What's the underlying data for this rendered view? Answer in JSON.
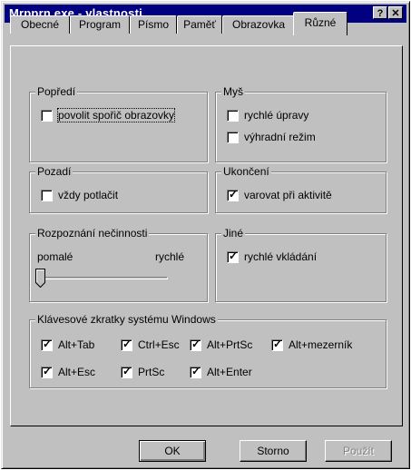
{
  "window": {
    "title": "Mrpprn.exe - vlastnosti",
    "help_button": "?",
    "close_button": "✕"
  },
  "tabs": [
    {
      "label": "Obecné",
      "active": false
    },
    {
      "label": "Program",
      "active": false
    },
    {
      "label": "Písmo",
      "active": false
    },
    {
      "label": "Paměť",
      "active": false
    },
    {
      "label": "Obrazovka",
      "active": false
    },
    {
      "label": "Různé",
      "active": true
    }
  ],
  "groups": {
    "popredi": {
      "label": "Popředí",
      "items": [
        {
          "label": "povolit spořič obrazovky",
          "checked": false
        }
      ]
    },
    "mys": {
      "label": "Myš",
      "items": [
        {
          "label": "rychlé úpravy",
          "checked": false
        },
        {
          "label": "výhradní režim",
          "checked": false
        }
      ]
    },
    "pozadi": {
      "label": "Pozadí",
      "items": [
        {
          "label": "vždy potlačit",
          "checked": false
        }
      ]
    },
    "ukonceni": {
      "label": "Ukončení",
      "items": [
        {
          "label": "varovat při aktivitě",
          "checked": true
        }
      ]
    },
    "necinnost": {
      "label": "Rozpoznání nečinnosti",
      "min_label": "pomalé",
      "max_label": "rychlé",
      "slider_value": 0
    },
    "jine": {
      "label": "Jiné",
      "items": [
        {
          "label": "rychlé vkládání",
          "checked": true
        }
      ]
    },
    "klavesy": {
      "label": "Klávesové zkratky systému Windows",
      "items": [
        {
          "label": "Alt+Tab",
          "checked": true
        },
        {
          "label": "Ctrl+Esc",
          "checked": true
        },
        {
          "label": "Alt+PrtSc",
          "checked": true
        },
        {
          "label": "Alt+mezerník",
          "checked": true
        },
        {
          "label": "Alt+Esc",
          "checked": true
        },
        {
          "label": "PrtSc",
          "checked": true
        },
        {
          "label": "Alt+Enter",
          "checked": true
        }
      ]
    }
  },
  "buttons": {
    "ok": "OK",
    "cancel": "Storno",
    "apply": "Použít"
  },
  "colors": {
    "titlebar": "#000080",
    "face": "#c0c0c0"
  }
}
